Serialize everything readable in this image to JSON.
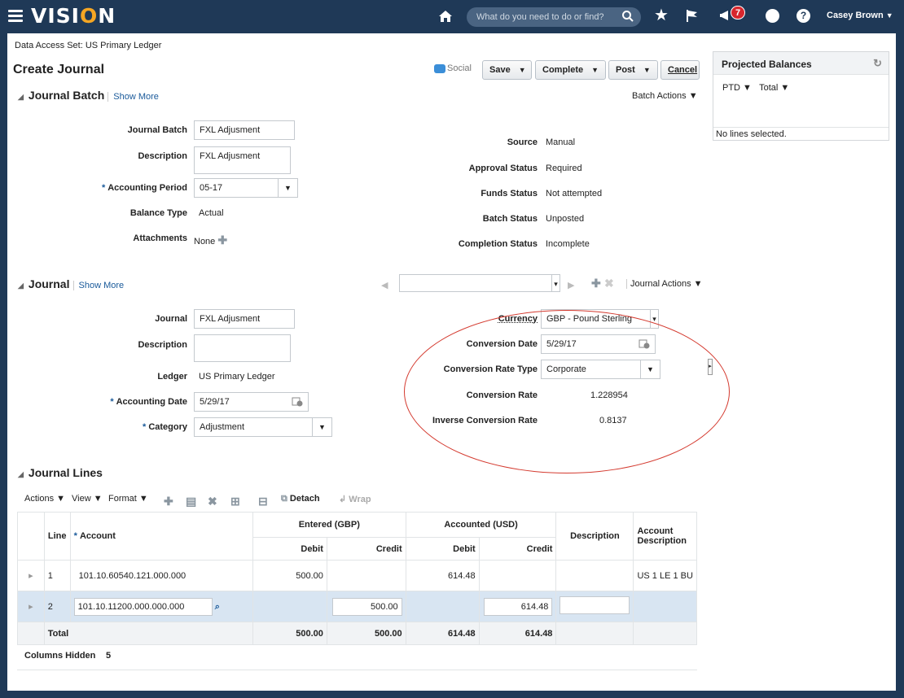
{
  "header": {
    "logo_pre": "VISI",
    "logo_o": "O",
    "logo_post": "N",
    "search_placeholder": "What do you need to do or find?",
    "notification_count": "7",
    "help_glyph": "?",
    "user_name": "Casey Brown"
  },
  "page": {
    "data_access": "Data Access Set: US Primary Ledger",
    "title": "Create Journal",
    "social": "Social",
    "buttons": {
      "save": "Save",
      "complete": "Complete",
      "post": "Post",
      "cancel": "Cancel"
    }
  },
  "projected": {
    "title": "Projected Balances",
    "ptd": "PTD",
    "total": "Total",
    "footer": "No lines selected."
  },
  "batch": {
    "title": "Journal Batch",
    "show_more": "Show More",
    "actions": "Batch Actions",
    "journal_batch_label": "Journal Batch",
    "journal_batch_value": "FXL Adjusment",
    "description_label": "Description",
    "description_value": "FXL Adjusment",
    "accounting_period_label": "Accounting Period",
    "accounting_period_value": "05-17",
    "balance_type_label": "Balance Type",
    "balance_type_value": "Actual",
    "attachments_label": "Attachments",
    "attachments_value": "None",
    "source_label": "Source",
    "source_value": "Manual",
    "approval_label": "Approval Status",
    "approval_value": "Required",
    "funds_label": "Funds Status",
    "funds_value": "Not attempted",
    "batch_status_label": "Batch Status",
    "batch_status_value": "Unposted",
    "completion_label": "Completion Status",
    "completion_value": "Incomplete"
  },
  "journal": {
    "title": "Journal",
    "show_more": "Show More",
    "actions": "Journal Actions",
    "journal_label": "Journal",
    "journal_value": "FXL Adjusment",
    "description_label": "Description",
    "ledger_label": "Ledger",
    "ledger_value": "US Primary Ledger",
    "accounting_date_label": "Accounting Date",
    "accounting_date_value": "5/29/17",
    "category_label": "Category",
    "category_value": "Adjustment",
    "currency_label": "Currency",
    "currency_value": "GBP - Pound Sterling",
    "conv_date_label": "Conversion Date",
    "conv_date_value": "5/29/17",
    "conv_rate_type_label": "Conversion Rate Type",
    "conv_rate_type_value": "Corporate",
    "conv_rate_label": "Conversion Rate",
    "conv_rate_value": "1.228954",
    "inv_rate_label": "Inverse Conversion Rate",
    "inv_rate_value": "0.8137"
  },
  "lines": {
    "title": "Journal Lines",
    "toolbar": {
      "actions": "Actions",
      "view": "View",
      "format": "Format",
      "detach": "Detach",
      "wrap": "Wrap"
    },
    "headers": {
      "line": "Line",
      "account": "Account",
      "entered": "Entered (GBP)",
      "accounted": "Accounted (USD)",
      "debit": "Debit",
      "credit": "Credit",
      "description": "Description",
      "account_description": "Account Description"
    },
    "rows": [
      {
        "line": "1",
        "account": "101.10.60540.121.000.000",
        "entered_debit": "500.00",
        "entered_credit": "",
        "acc_debit": "614.48",
        "acc_credit": "",
        "description": "",
        "account_description": "US 1 LE 1 BU"
      },
      {
        "line": "2",
        "account": "101.10.11200.000.000.000",
        "entered_debit": "",
        "entered_credit": "500.00",
        "acc_debit": "",
        "acc_credit": "614.48",
        "description": "",
        "account_description": ""
      }
    ],
    "total": {
      "label": "Total",
      "entered_debit": "500.00",
      "entered_credit": "500.00",
      "acc_debit": "614.48",
      "acc_credit": "614.48"
    },
    "columns_hidden_label": "Columns Hidden",
    "columns_hidden_value": "5"
  },
  "colors": {
    "nav": "#1f3957",
    "accent": "#1a5a9a",
    "highlight_circle": "#d43a2f",
    "selected_row": "#d8e5f2"
  }
}
